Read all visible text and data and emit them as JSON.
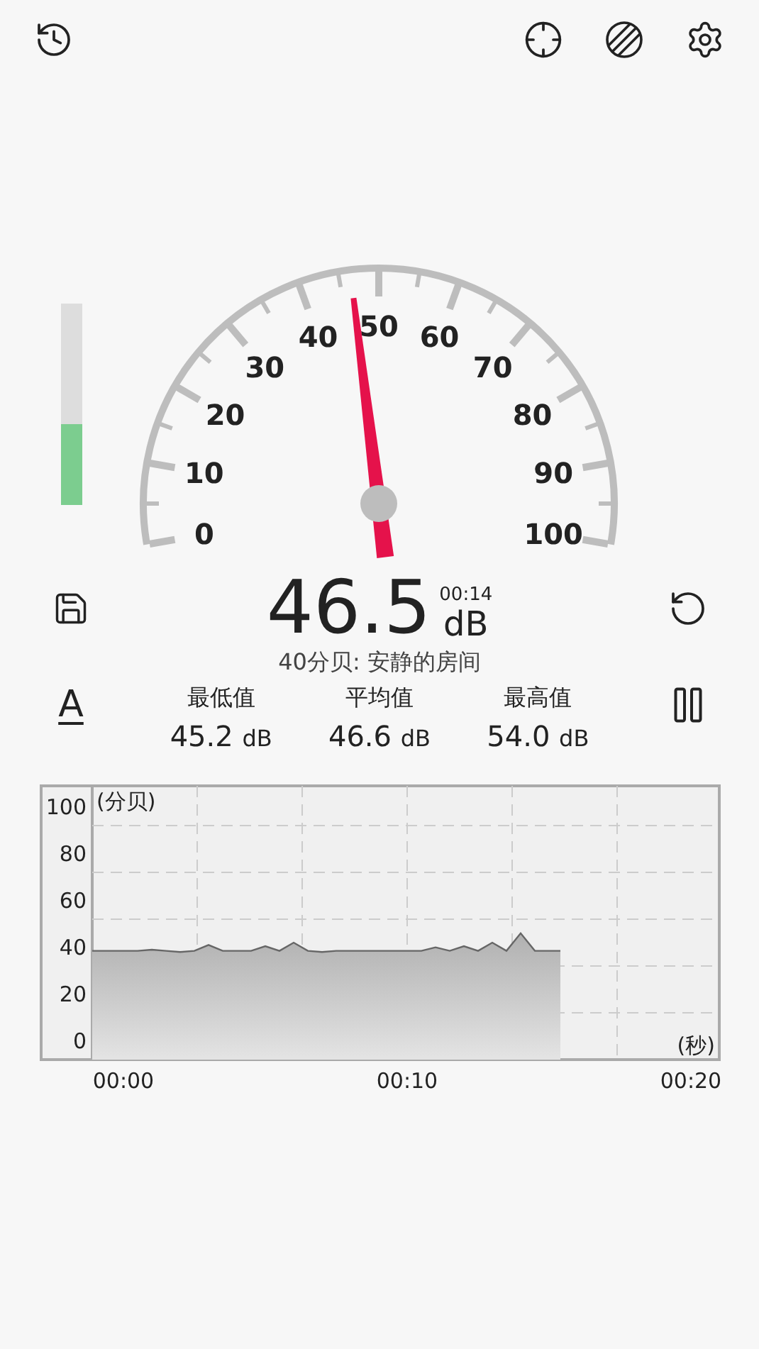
{
  "gauge": {
    "labels": [
      "50",
      "40",
      "60",
      "30",
      "70",
      "20",
      "80",
      "10",
      "90",
      "0",
      "100"
    ]
  },
  "level_meter": {
    "level": 0.4
  },
  "reading": {
    "value": "46.5",
    "unit": "dB",
    "elapsed": "00:14",
    "description": "40分贝: 安静的房间"
  },
  "weighting": "A",
  "stats": [
    {
      "label": "最低值",
      "value": "45.2",
      "unit": "dB"
    },
    {
      "label": "平均值",
      "value": "46.6",
      "unit": "dB"
    },
    {
      "label": "最高值",
      "value": "54.0",
      "unit": "dB"
    }
  ],
  "history": {
    "chart_data": {
      "type": "area",
      "ylabel": "(分贝)",
      "xlabel": "(秒)",
      "grid": true,
      "ylim": [
        0,
        117
      ],
      "xlim": [
        -1.1,
        21
      ],
      "yticks": [
        0,
        20,
        40,
        60,
        80,
        100
      ],
      "xticks": [
        {
          "value": 0,
          "label": "00:00"
        },
        {
          "value": 10,
          "label": "00:10"
        },
        {
          "value": 20,
          "label": "00:20"
        }
      ],
      "x": [
        -1.1,
        0,
        0.5,
        1,
        1.5,
        2,
        2.5,
        3,
        3.5,
        4,
        4.5,
        5,
        5.5,
        6,
        6.5,
        7,
        7.5,
        8,
        8.5,
        9,
        9.5,
        10,
        10.5,
        11,
        11.5,
        12,
        12.5,
        13,
        13.5,
        14,
        14.5,
        15,
        15.4
      ],
      "values": [
        46.5,
        46.5,
        46.5,
        47,
        46.5,
        46,
        46.5,
        49,
        46.5,
        46.5,
        46.5,
        48.5,
        46.5,
        50,
        46.5,
        46,
        46.5,
        46.5,
        46.5,
        46.5,
        46.5,
        46.5,
        46.5,
        48,
        46.5,
        48.5,
        46.5,
        50,
        46.5,
        54,
        46.5,
        46.5,
        46.5
      ]
    }
  }
}
